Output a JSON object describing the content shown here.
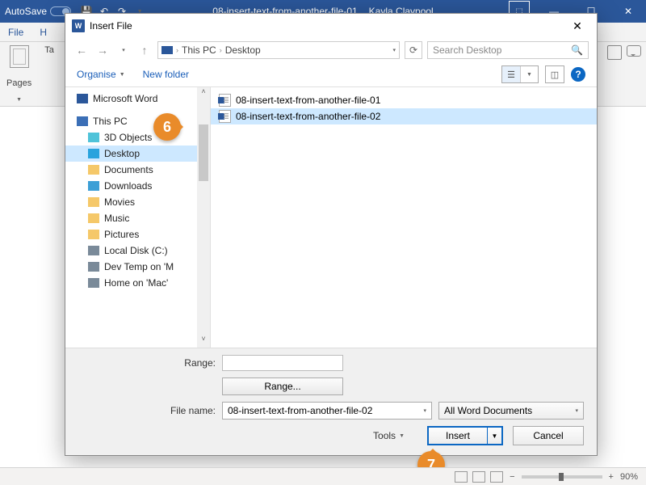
{
  "word": {
    "autosave_label": "AutoSave",
    "doc_name": "08-insert-text-from-another-file-01",
    "user_name": "Kayla Claypool",
    "tabs": {
      "file": "File",
      "home_initial": "H"
    },
    "ribbon": {
      "pages": "Pages",
      "tables": "Ta"
    }
  },
  "dialog": {
    "title": "Insert File",
    "path": {
      "root": "This PC",
      "current": "Desktop"
    },
    "search_placeholder": "Search Desktop",
    "toolbar": {
      "organise": "Organise",
      "new_folder": "New folder"
    },
    "tree": [
      {
        "label": "Microsoft Word",
        "icon": "word"
      },
      {
        "label": "This PC",
        "icon": "thispc"
      },
      {
        "label": "3D Objects",
        "icon": "3d"
      },
      {
        "label": "Desktop",
        "icon": "desktop",
        "selected": true
      },
      {
        "label": "Documents",
        "icon": "folder"
      },
      {
        "label": "Downloads",
        "icon": "dl"
      },
      {
        "label": "Movies",
        "icon": "folder"
      },
      {
        "label": "Music",
        "icon": "folder"
      },
      {
        "label": "Pictures",
        "icon": "folder"
      },
      {
        "label": "Local Disk (C:)",
        "icon": "drive"
      },
      {
        "label": "Dev Temp on 'M",
        "icon": "drive"
      },
      {
        "label": "Home on 'Mac'",
        "icon": "drive"
      }
    ],
    "files": [
      {
        "name": "08-insert-text-from-another-file-01",
        "selected": false
      },
      {
        "name": "08-insert-text-from-another-file-02",
        "selected": true
      }
    ],
    "footer": {
      "range_label": "Range:",
      "range_button": "Range...",
      "filename_label": "File name:",
      "filename_value": "08-insert-text-from-another-file-02",
      "filter": "All Word Documents",
      "tools": "Tools",
      "insert": "Insert",
      "cancel": "Cancel"
    }
  },
  "callouts": {
    "six": "6",
    "seven": "7"
  },
  "status": {
    "zoom": "90%"
  }
}
